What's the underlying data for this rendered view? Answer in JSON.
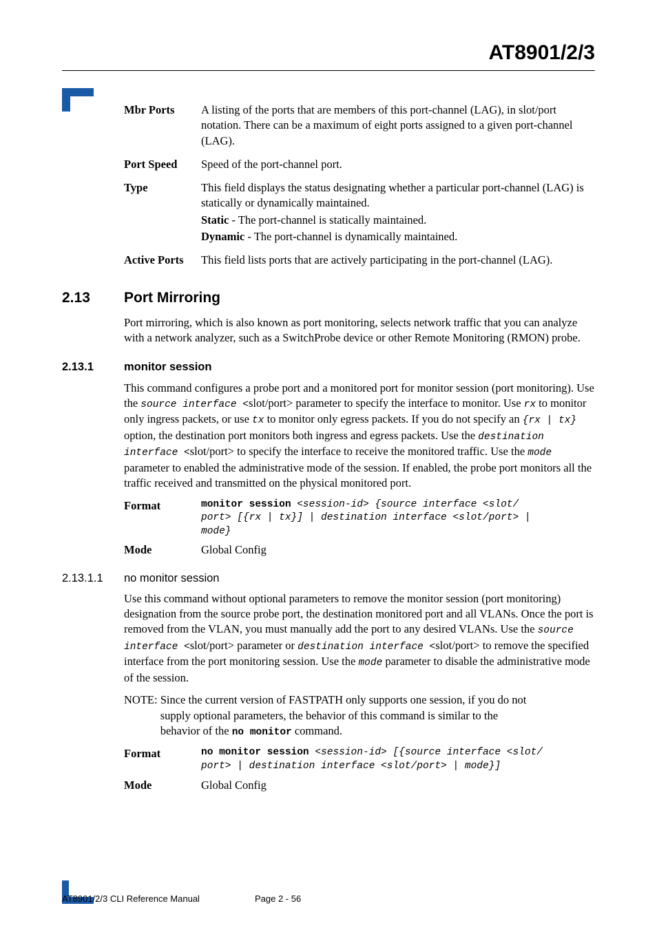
{
  "header": {
    "title": "AT8901/2/3"
  },
  "defs": [
    {
      "term": "Mbr Ports",
      "desc_html": "A listing of the ports that are members of this port-channel (LAG), in slot/port notation. There can be a maximum of eight ports assigned to a given port-channel (LAG)."
    },
    {
      "term": "Port Speed",
      "desc_html": "Speed of the port-channel port."
    },
    {
      "term": "Type",
      "desc_html": "This field displays the status designating whether a particular port-channel (LAG) is statically or dynamically maintained.|<b>Static</b> - The port-channel is statically maintained.|<b>Dynamic</b> - The port-channel is dynamically maintained."
    },
    {
      "term": "Active Ports",
      "desc_html": "This field lists ports that are actively participating in the port-channel (LAG)."
    }
  ],
  "sec213": {
    "num": "2.13",
    "title": "Port Mirroring",
    "para": "Port mirroring, which is also known as port monitoring, selects network traffic that you can analyze with a network analyzer, such as a SwitchProbe device or other Remote Monitoring (RMON) probe."
  },
  "sec2131": {
    "num": "2.13.1",
    "title": "monitor session",
    "para_parts": [
      "This command configures a probe port and a monitored port for monitor session (port monitoring). Use the ",
      "source interface <",
      "slot/port",
      "> ",
      "parameter to specify the interface to monitor. Use ",
      "rx",
      " to monitor only ingress packets, or use ",
      "tx",
      " to monitor only egress packets. If you do not specify an ",
      "{rx | tx}",
      " option, the destination port monitors both ingress and egress packets. Use the ",
      "destination interface <",
      "slot/port",
      "> ",
      " to specify the interface to receive the monitored traffic. Use the ",
      "mode",
      " parameter to enabled the administrative mode of the session. If enabled, the probe port monitors all the traffic received and transmitted on the physical monitored port."
    ],
    "format_label": "Format",
    "format_code": {
      "bold": "monitor session ",
      "rest": "<session-id> {source interface <slot/\nport> [{rx | tx}] | destination interface <slot/port> | \nmode}"
    },
    "mode_label": "Mode",
    "mode_value": "Global Config"
  },
  "sec21311": {
    "num": "2.13.1.1",
    "title": "no monitor session",
    "para_parts": [
      "Use this command without optional parameters to remove the monitor session (port monitoring) designation from the source probe port, the destination monitored port and all VLANs. Once the port is removed from the VLAN, you must manually add the port to any desired VLANs. Use the ",
      "source interface <",
      "slot/port",
      "> ",
      "parameter or ",
      "destination interface <",
      "slot/port",
      "> ",
      " to remove the specified interface from the port monitoring session. Use the ",
      "mode",
      " parameter to disable the administrative mode of the session."
    ],
    "note_label": "NOTE: ",
    "note_parts": [
      "Since the current version of FASTPATH only supports one session, if you do not supply optional parameters, the behavior of this command is similar to the behavior of the ",
      "no monitor",
      " command."
    ],
    "format_label": "Format",
    "format_code": {
      "bold": "no monitor session ",
      "rest": "<session-id> [{source interface <slot/\nport> | destination interface <slot/port> | mode}]"
    },
    "mode_label": "Mode",
    "mode_value": "Global Config"
  },
  "footer": {
    "left": "AT8901/2/3 CLI Reference Manual",
    "center": "Page 2 - 56"
  }
}
